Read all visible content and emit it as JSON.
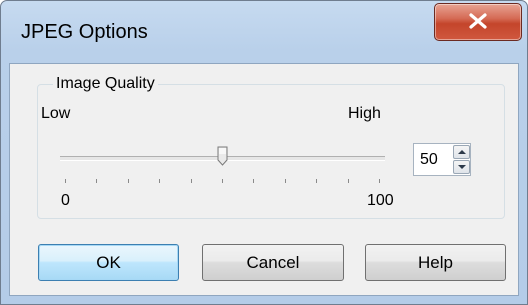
{
  "window": {
    "title": "JPEG Options"
  },
  "group": {
    "title": "Image Quality",
    "low_label": "Low",
    "high_label": "High",
    "min_label": "0",
    "max_label": "100"
  },
  "quality": {
    "value": "50",
    "min": 0,
    "max": 100,
    "tick_count": 11
  },
  "buttons": {
    "ok": "OK",
    "cancel": "Cancel",
    "help": "Help"
  },
  "icons": {
    "close": "close-icon",
    "spin_up": "arrow-up-icon",
    "spin_down": "arrow-down-icon",
    "slider_thumb": "slider-thumb-icon"
  },
  "colors": {
    "close_button": "#c4452b",
    "titlebar": "#b9d0ea",
    "dialog_face": "#f0f0f0",
    "default_button_border": "#3c7fb1"
  }
}
